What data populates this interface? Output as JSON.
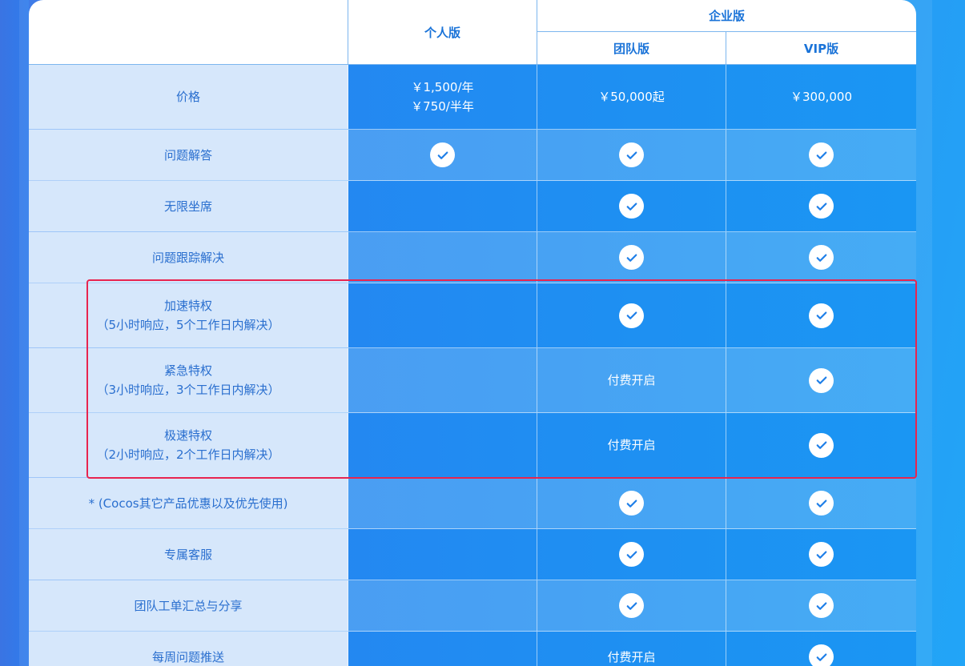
{
  "header": {
    "personal": "个人版",
    "enterprise": "企业版",
    "team": "团队版",
    "vip": "VIP版"
  },
  "rows": [
    {
      "feature": [
        "价格"
      ],
      "personal": [
        "￥1,500/年",
        "￥750/半年"
      ],
      "team": "￥50,000起",
      "vip": "￥300,000",
      "shade": "dark"
    },
    {
      "feature": [
        "问题解答"
      ],
      "personal": "check",
      "team": "check",
      "vip": "check",
      "shade": "light"
    },
    {
      "feature": [
        "无限坐席"
      ],
      "personal": "",
      "team": "check",
      "vip": "check",
      "shade": "dark"
    },
    {
      "feature": [
        "问题跟踪解决"
      ],
      "personal": "",
      "team": "check",
      "vip": "check",
      "shade": "light"
    },
    {
      "feature": [
        "加速特权",
        "（5小时响应，5个工作日内解决）"
      ],
      "personal": "",
      "team": "check",
      "vip": "check",
      "shade": "dark"
    },
    {
      "feature": [
        "紧急特权",
        "（3小时响应，3个工作日内解决）"
      ],
      "personal": "",
      "team": "付费开启",
      "vip": "check",
      "shade": "light"
    },
    {
      "feature": [
        "极速特权",
        "（2小时响应，2个工作日内解决）"
      ],
      "personal": "",
      "team": "付费开启",
      "vip": "check",
      "shade": "dark"
    },
    {
      "feature": [
        "* (Cocos其它产品优惠以及优先使用)"
      ],
      "personal": "",
      "team": "check",
      "vip": "check",
      "shade": "light"
    },
    {
      "feature": [
        "专属客服"
      ],
      "personal": "",
      "team": "check",
      "vip": "check",
      "shade": "dark"
    },
    {
      "feature": [
        "团队工单汇总与分享"
      ],
      "personal": "",
      "team": "check",
      "vip": "check",
      "shade": "light"
    },
    {
      "feature": [
        "每周问题推送"
      ],
      "personal": "",
      "team": "付费开启",
      "vip": "check",
      "shade": "dark"
    }
  ],
  "icons": {
    "check": "check-circle-icon"
  },
  "colors": {
    "highlight_border": "#e8244f",
    "feature_column_bg": "#d6e7fb",
    "header_text": "#1a73d8"
  }
}
